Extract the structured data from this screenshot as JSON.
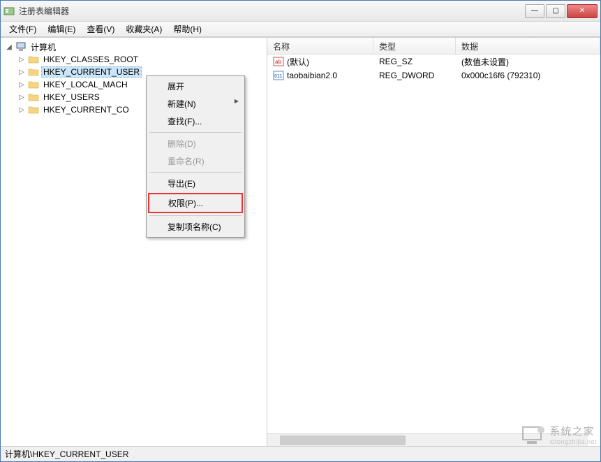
{
  "window": {
    "title": "注册表编辑器"
  },
  "menubar": {
    "file": "文件(F)",
    "edit": "编辑(E)",
    "view": "查看(V)",
    "favorites": "收藏夹(A)",
    "help": "帮助(H)"
  },
  "tree": {
    "root": "计算机",
    "hkcr": "HKEY_CLASSES_ROOT",
    "hkcu": "HKEY_CURRENT_USER",
    "hklm": "HKEY_LOCAL_MACH",
    "hku": "HKEY_USERS",
    "hkcc": "HKEY_CURRENT_CO"
  },
  "list": {
    "headers": {
      "name": "名称",
      "type": "类型",
      "data": "数据"
    },
    "rows": [
      {
        "name": "(默认)",
        "type": "REG_SZ",
        "data": "(数值未设置)",
        "icon": "ab"
      },
      {
        "name": "taobaibian2.0",
        "type": "REG_DWORD",
        "data": "0x000c16f6 (792310)",
        "icon": "011"
      }
    ]
  },
  "context_menu": {
    "expand": "展开",
    "new": "新建(N)",
    "find": "查找(F)...",
    "delete": "删除(D)",
    "rename": "重命名(R)",
    "export": "导出(E)",
    "permissions": "权限(P)...",
    "copy_key_name": "复制项名称(C)"
  },
  "statusbar": {
    "path": "计算机\\HKEY_CURRENT_USER"
  },
  "watermark": {
    "title": "系统之家",
    "sub": "xitongzhijia.net"
  }
}
